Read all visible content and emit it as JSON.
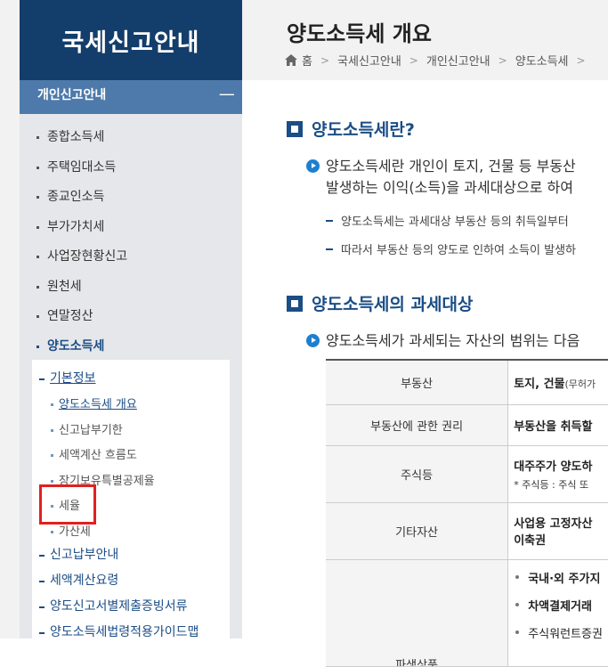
{
  "sidebar": {
    "header": "국세신고안내",
    "section": "개인신고안내",
    "collapse_symbol": "ㅡ",
    "menu": [
      "종합소득세",
      "주택임대소득",
      "종교인소득",
      "부가가치세",
      "사업장현황신고",
      "원천세",
      "연말정산",
      "양도소득세"
    ],
    "sub_top": "기본정보",
    "sub_items": [
      "양도소득세 개요",
      "신고납부기한",
      "세액계산 흐름도",
      "장기보유특별공제율",
      "세율",
      "가산세"
    ],
    "sub_bottom": [
      "신고납부안내",
      "세액계산요령",
      "양도신고서별제출증빙서류",
      "양도소득세법령적용가이드맵"
    ]
  },
  "main": {
    "title": "양도소득세 개요",
    "breadcrumb": [
      "홈",
      "국세신고안내",
      "개인신고안내",
      "양도소득세"
    ],
    "section1": {
      "heading": "양도소득세란?",
      "line1": "양도소득세란 개인이 토지, 건물 등 부동산",
      "line2": "발생하는 이익(소득)을 과세대상으로 하여",
      "dash1": "양도소득세는 과세대상 부동산 등의 취득일부터",
      "dash2": "따라서 부동산 등의 양도로 인하여 소득이 발생하"
    },
    "section2": {
      "heading": "양도소득세의 과세대상",
      "line1": "양도소득세가 과세되는 자산의 범위는 다음"
    },
    "table": [
      {
        "label": "부동산",
        "value": "토지, 건물",
        "value_extra": "(무허가"
      },
      {
        "label": "부동산에 관한 권리",
        "value": "부동산을 취득할"
      },
      {
        "label": "주식등",
        "value": "대주주가 양도하",
        "note": "* 주식등 : 주식 또"
      },
      {
        "label": "기타자산",
        "value": "사업용 고정자산",
        "value2": "이축권"
      },
      {
        "label": "파생상품",
        "bullets": [
          "국내·외 주가지",
          "차액결제거래",
          "주식워런트증권"
        ]
      }
    ]
  }
}
